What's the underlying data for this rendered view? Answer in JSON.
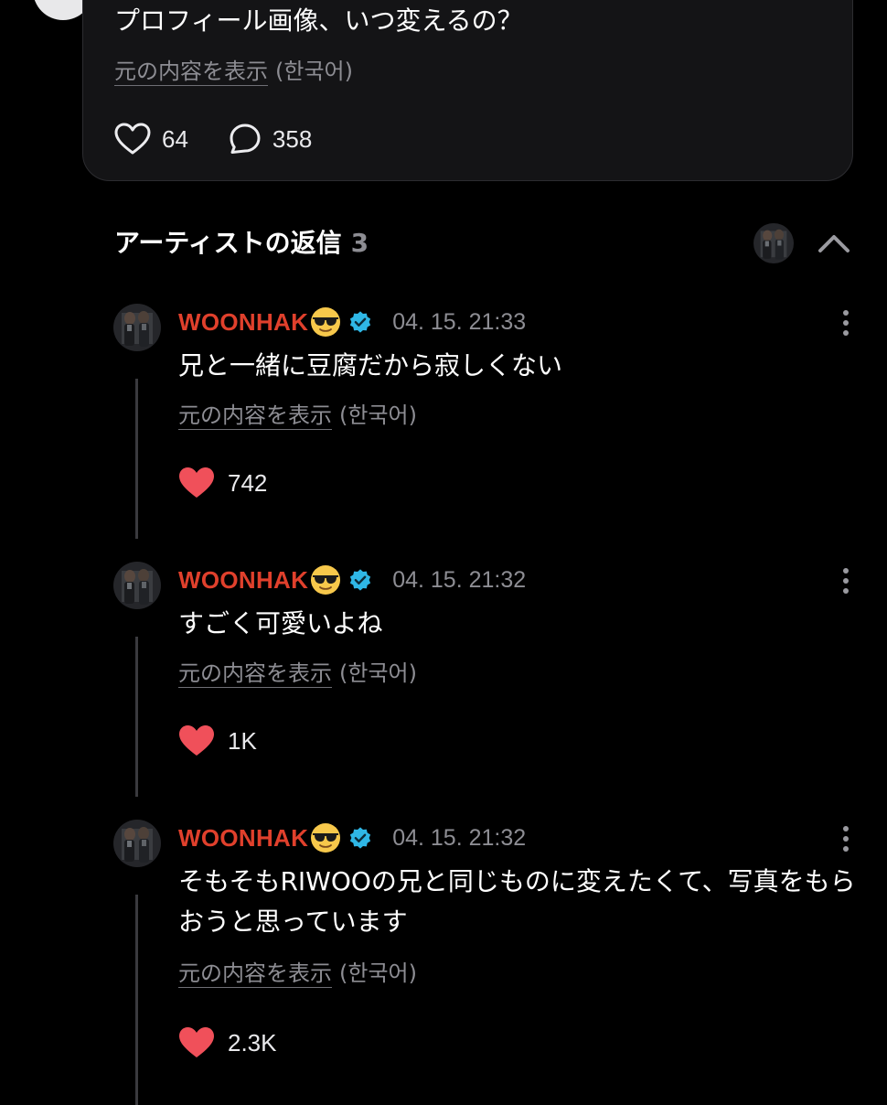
{
  "post": {
    "text": "プロフィール画像、いつ変えるの？",
    "translate_label": "元の内容を表示",
    "translate_lang": "(한국어)",
    "likes": "64",
    "comments": "358"
  },
  "replies_section": {
    "title": "アーティストの返信",
    "count": "3"
  },
  "replies": [
    {
      "author": "WOONHAK",
      "timestamp": "04. 15. 21:33",
      "text": "兄と一緒に豆腐だから寂しくない",
      "translate_label": "元の内容を表示",
      "translate_lang": "(한국어)",
      "likes": "742"
    },
    {
      "author": "WOONHAK",
      "timestamp": "04. 15. 21:32",
      "text": "すごく可愛いよね",
      "translate_label": "元の内容を表示",
      "translate_lang": "(한국어)",
      "likes": "1K"
    },
    {
      "author": "WOONHAK",
      "timestamp": "04. 15. 21:32",
      "text": "そもそもRIWOOの兄と同じものに変えたくて、写真をもらおうと思っています",
      "translate_label": "元の内容を表示",
      "translate_lang": "(한국어)",
      "likes": "2.3K"
    }
  ],
  "colors": {
    "background": "#000000",
    "card": "#141416",
    "author_name": "#e0402c",
    "liked_heart": "#f0505a",
    "verified_badge": "#2fb7e6",
    "muted_text": "#8d8d93"
  },
  "icons": {
    "like": "heart-outline-icon",
    "comment": "speech-bubble-icon",
    "liked": "heart-filled-icon",
    "verified": "verified-badge-icon",
    "more": "vertical-ellipsis-icon",
    "collapse": "chevron-up-icon",
    "emoji": "sunglasses-emoji-icon"
  }
}
